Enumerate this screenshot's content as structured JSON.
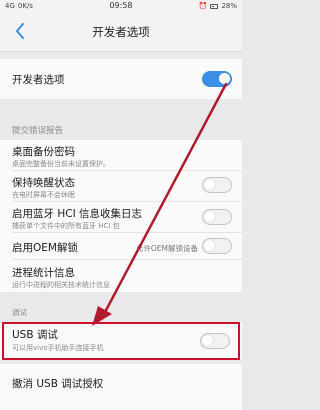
{
  "status_bar": {
    "left_text": "4G",
    "network": "0K/s",
    "time": "09:58",
    "battery_percent": "28%"
  },
  "nav": {
    "title": "开发者选项",
    "back_icon": "chevron-left-icon"
  },
  "developer_options": {
    "label": "开发者选项",
    "enabled": true
  },
  "sections": {
    "debug_report_header": "提交错误报告",
    "debug_header": "调试"
  },
  "settings": [
    {
      "label": "桌面备份密码",
      "sub": "桌面完整备份当前未设置保护。"
    },
    {
      "label": "保持唤醒状态",
      "sub": "充电时屏幕不会休眠",
      "toggle": false
    },
    {
      "label": "启用蓝牙 HCI 信息收集日志",
      "sub": "捕获单个文件中的所有蓝牙 HCI 包",
      "toggle": false
    },
    {
      "label": "启用OEM解锁",
      "trailing": "允许OEM解锁设备",
      "toggle": false
    },
    {
      "label": "进程统计信息",
      "sub": "运行中进程的相关技术统计信息"
    }
  ],
  "usb_debug": {
    "label": "USB 调试",
    "sub": "可以用vivo手机助手连接手机",
    "enabled": false
  },
  "revoke_usb": {
    "label": "撤消 USB 调试授权"
  },
  "colors": {
    "accent": "#3a8ee6",
    "highlight": "#c8102e",
    "arrow": "#b01a2a"
  }
}
